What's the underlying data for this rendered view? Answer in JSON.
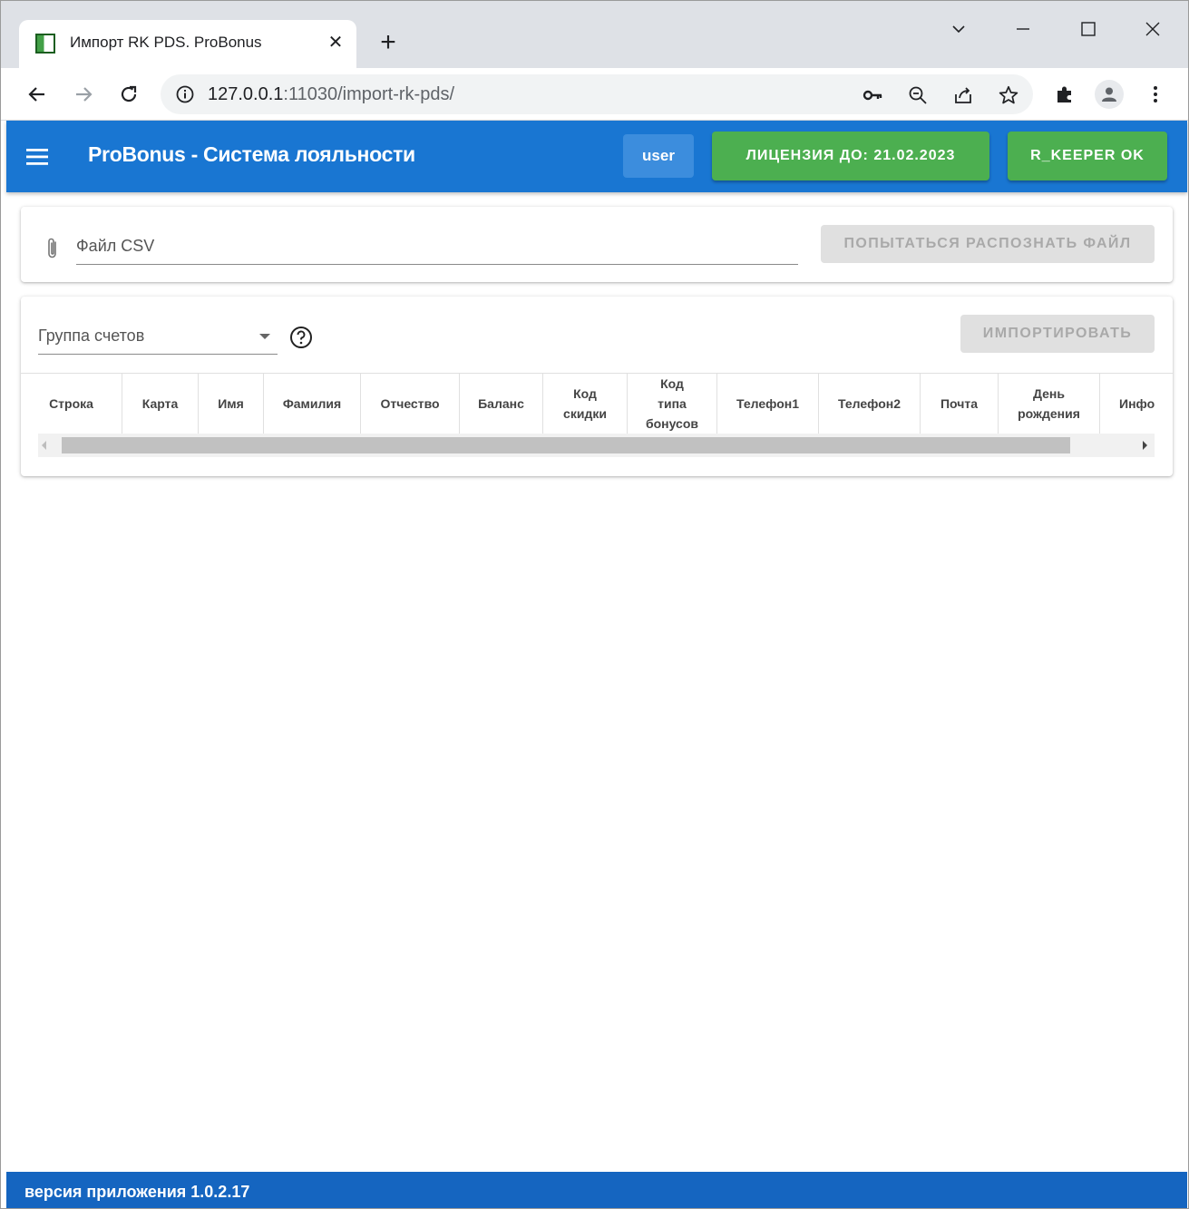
{
  "browser": {
    "tab_title": "Импорт RK PDS. ProBonus",
    "url_host": "127.0.0.1",
    "url_rest": ":11030/import-rk-pds/"
  },
  "app": {
    "title": "ProBonus - Система лояльности",
    "user_label": "user",
    "license_label": "ЛИЦЕНЗИЯ ДО: 21.02.2023",
    "rkeeper_label": "R_KEEPER OK",
    "accent_color": "#1976d2",
    "ok_color": "#4caf50"
  },
  "file_card": {
    "file_label": "Файл CSV",
    "recognize_button": "ПОПЫТАТЬСЯ РАСПОЗНАТЬ ФАЙЛ"
  },
  "import_card": {
    "group_label": "Группа счетов",
    "import_button": "ИМПОРТИРОВАТЬ",
    "columns": [
      "Строка",
      "Карта",
      "Имя",
      "Фамилия",
      "Отчество",
      "Баланс",
      "Код\nскидки",
      "Код\nтипа\nбонусов",
      "Телефон1",
      "Телефон2",
      "Почта",
      "День\nрождения",
      "Инфо"
    ]
  },
  "footer": {
    "version_text": "версия приложения 1.0.2.17"
  }
}
